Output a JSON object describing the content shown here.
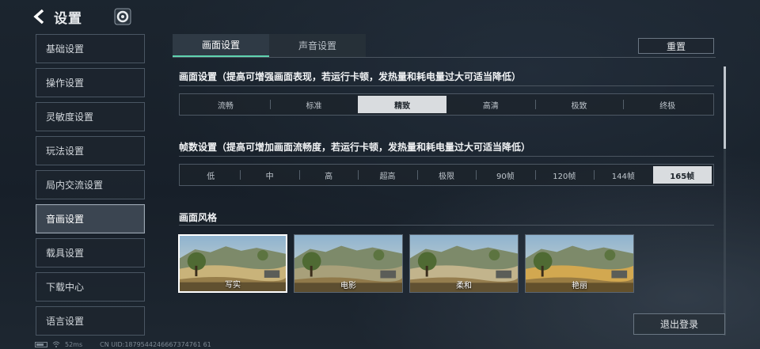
{
  "header": {
    "title": "设置"
  },
  "sidebar": {
    "items": [
      {
        "label": "基础设置"
      },
      {
        "label": "操作设置"
      },
      {
        "label": "灵敏度设置"
      },
      {
        "label": "玩法设置"
      },
      {
        "label": "局内交流设置"
      },
      {
        "label": "音画设置",
        "active": true
      },
      {
        "label": "载具设置"
      },
      {
        "label": "下载中心"
      },
      {
        "label": "语言设置"
      }
    ]
  },
  "tabs": [
    {
      "label": "画面设置",
      "active": true
    },
    {
      "label": "声音设置"
    }
  ],
  "reset_label": "重置",
  "graphics": {
    "title": "画面设置（提高可增强画面表现，若运行卡顿，发热量和耗电量过大可适当降低）",
    "options": [
      "流畅",
      "标准",
      "精致",
      "高清",
      "极致",
      "终极"
    ],
    "selected": "精致"
  },
  "framerate": {
    "title": "帧数设置（提高可增加画面流畅度，若运行卡顿，发热量和耗电量过大可适当降低）",
    "options": [
      "低",
      "中",
      "高",
      "超高",
      "极限",
      "90帧",
      "120帧",
      "144帧",
      "165帧"
    ],
    "selected": "165帧"
  },
  "style": {
    "title": "画面风格",
    "options": [
      {
        "label": "写实",
        "tint": "#c9b37a"
      },
      {
        "label": "电影",
        "tint": "#a8a07a"
      },
      {
        "label": "柔和",
        "tint": "#c2b48c"
      },
      {
        "label": "艳丽",
        "tint": "#d2a850"
      }
    ],
    "selected": "写实"
  },
  "logout_label": "退出登录",
  "status": {
    "ping": "52ms",
    "uid": "CN UID:1879544246667374761 61"
  },
  "colors": {
    "accent": "#5fd3b0",
    "selected_bg": "#d9dcdf"
  }
}
